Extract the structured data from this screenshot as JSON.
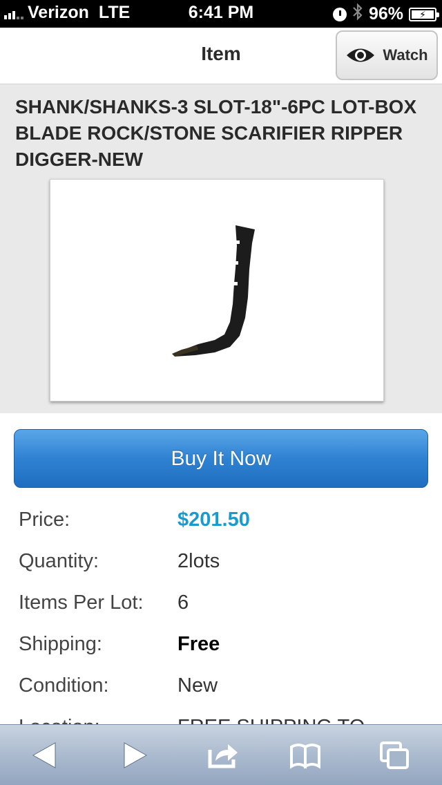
{
  "status_bar": {
    "carrier": "Verizon",
    "network": "LTE",
    "time": "6:41 PM",
    "battery": "96%"
  },
  "header": {
    "title": "Item",
    "watch_label": "Watch"
  },
  "listing": {
    "title": "SHANK/SHANKS-3 SLOT-18\"-6PC LOT-BOX BLADE ROCK/STONE SCARIFIER RIPPER DIGGER-NEW",
    "buy_label": "Buy It Now"
  },
  "details": {
    "price_label": "Price:",
    "price_value": "$201.50",
    "quantity_label": "Quantity:",
    "quantity_value": "2lots",
    "items_per_lot_label": "Items Per Lot:",
    "items_per_lot_value": "6",
    "shipping_label": "Shipping:",
    "shipping_value": "Free",
    "condition_label": "Condition:",
    "condition_value": "New",
    "location_label": "Location:",
    "location_value": "FREE SHIPPING TO"
  },
  "toolbar": {
    "icons": [
      "back-icon",
      "forward-icon",
      "share-icon",
      "bookmarks-icon",
      "tabs-icon"
    ]
  },
  "colors": {
    "price": "#1a9bd0",
    "buy_button": "#2f82d2",
    "title_bg": "#e9e9e9"
  }
}
